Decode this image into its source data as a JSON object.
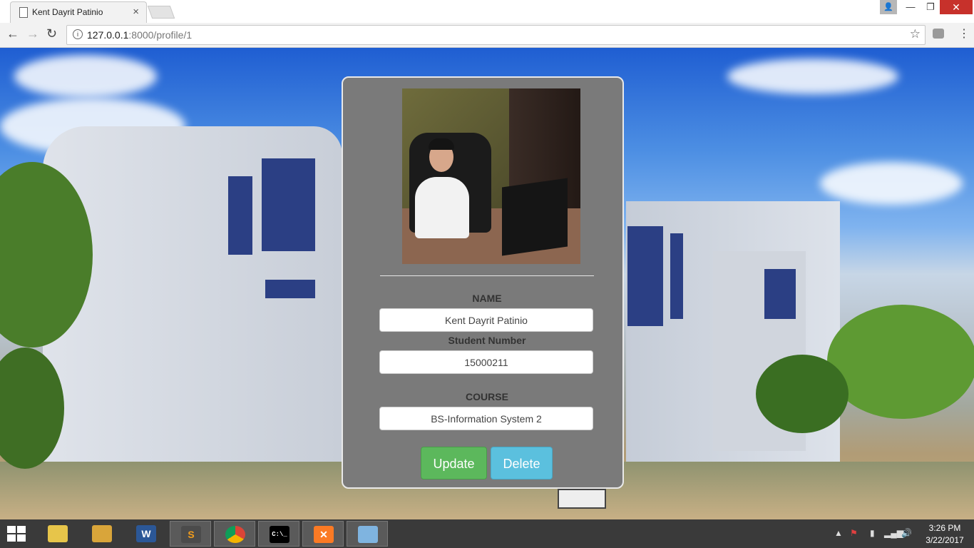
{
  "browser": {
    "tab_title": "Kent Dayrit Patinio",
    "tab_close": "×",
    "url_host": "127.0.0.1",
    "url_path": ":8000/profile/1",
    "back": "←",
    "forward": "→",
    "reload": "↻",
    "star": "☆",
    "menu": "⋮",
    "info": "i",
    "win_min": "—",
    "win_max": "❐",
    "win_close": "✕"
  },
  "profile": {
    "name_label": "NAME",
    "name_value": "Kent Dayrit Patinio",
    "student_number_label": "Student Number",
    "student_number_value": "15000211",
    "course_label": "COURSE",
    "course_value": "BS-Information System 2",
    "update_label": "Update",
    "delete_label": "Delete"
  },
  "taskbar": {
    "apps": [
      {
        "name": "file-explorer",
        "glyph": ""
      },
      {
        "name": "folder",
        "glyph": ""
      },
      {
        "name": "word",
        "glyph": "W"
      },
      {
        "name": "sublime-text",
        "glyph": "S"
      },
      {
        "name": "chrome",
        "glyph": ""
      },
      {
        "name": "command-prompt",
        "glyph": "C:\\_"
      },
      {
        "name": "xampp",
        "glyph": "✕"
      },
      {
        "name": "paint",
        "glyph": ""
      }
    ],
    "time": "3:26 PM",
    "date": "3/22/2017"
  },
  "colors": {
    "update_button": "#5cb85c",
    "delete_button": "#5bc0de",
    "card_background": "#7a7a7a",
    "window_close": "#c7312b"
  }
}
